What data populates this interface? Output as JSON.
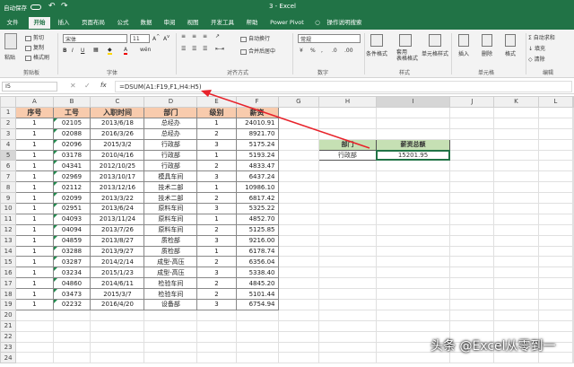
{
  "title": {
    "text": "3  -  Excel",
    "autosave": "自动保存"
  },
  "tabs": [
    "文件",
    "开始",
    "插入",
    "页面布局",
    "公式",
    "数据",
    "审阅",
    "视图",
    "开发工具",
    "帮助",
    "Power Pivot",
    "操作说明搜索"
  ],
  "ribbon": {
    "clipboard": {
      "cut": "剪切",
      "copy": "复制",
      "format_painter": "格式刷",
      "paste": "粘贴",
      "group": "剪贴板"
    },
    "font": {
      "name": "宋体",
      "size": "11",
      "group": "字体"
    },
    "align": {
      "wrap": "自动换行",
      "merge": "合并后居中",
      "group": "对齐方式"
    },
    "number": {
      "format": "常规",
      "group": "数字"
    },
    "styles": {
      "cond": "条件格式",
      "table": "套用\n表格格式",
      "cell": "单元格样式",
      "group": "样式"
    },
    "cells": {
      "insert": "插入",
      "delete": "删除",
      "format": "格式",
      "group": "单元格"
    },
    "edit": {
      "autosum": "自动求和",
      "fill": "填充",
      "clear": "清除",
      "group": "编辑"
    }
  },
  "formula_bar": {
    "name_box": "I5",
    "fx": "fx",
    "formula": "=DSUM(A1:F19,F1,H4:H5)"
  },
  "columns": [
    "A",
    "B",
    "C",
    "D",
    "E",
    "F",
    "G",
    "H",
    "I",
    "J",
    "K",
    "L"
  ],
  "header": [
    "序号",
    "工号",
    "入职时间",
    "部门",
    "级别",
    "薪资"
  ],
  "rows": [
    [
      "1",
      "02105",
      "2013/6/18",
      "总经办",
      "1",
      "24010.91"
    ],
    [
      "1",
      "02088",
      "2016/3/26",
      "总经办",
      "2",
      "8921.70"
    ],
    [
      "1",
      "02096",
      "2015/3/2",
      "行政部",
      "3",
      "5175.24"
    ],
    [
      "1",
      "03178",
      "2010/4/16",
      "行政部",
      "1",
      "5193.24"
    ],
    [
      "1",
      "04341",
      "2012/10/25",
      "行政部",
      "2",
      "4833.47"
    ],
    [
      "1",
      "02969",
      "2013/10/17",
      "模具车间",
      "3",
      "6437.24"
    ],
    [
      "1",
      "02112",
      "2013/12/16",
      "技术二部",
      "1",
      "10986.10"
    ],
    [
      "1",
      "02099",
      "2013/3/22",
      "技术二部",
      "2",
      "6817.42"
    ],
    [
      "1",
      "02951",
      "2013/6/24",
      "原料车间",
      "3",
      "5325.22"
    ],
    [
      "1",
      "04093",
      "2013/11/24",
      "原料车间",
      "1",
      "4852.70"
    ],
    [
      "1",
      "04094",
      "2013/7/26",
      "原料车间",
      "2",
      "5125.85"
    ],
    [
      "1",
      "04859",
      "2013/8/27",
      "质检部",
      "3",
      "9216.00"
    ],
    [
      "1",
      "03288",
      "2013/9/27",
      "质检部",
      "1",
      "6178.74"
    ],
    [
      "1",
      "03287",
      "2014/2/14",
      "成型-高压",
      "2",
      "6356.04"
    ],
    [
      "1",
      "03234",
      "2015/1/23",
      "成型-高压",
      "3",
      "5338.40"
    ],
    [
      "1",
      "04860",
      "2014/6/11",
      "检验车间",
      "2",
      "4845.20"
    ],
    [
      "1",
      "03473",
      "2015/3/7",
      "检验车间",
      "2",
      "5101.44"
    ],
    [
      "1",
      "02232",
      "2016/4/20",
      "设备部",
      "3",
      "6754.94"
    ]
  ],
  "criteria": {
    "h_header": "部门",
    "h_value": "行政部",
    "i_header": "薪资总额",
    "i_value": "15201.95"
  },
  "watermark": "头条 @Excel从零到一",
  "colors": {
    "excel_green": "#217346",
    "header_fill": "#f8cbad",
    "criteria_fill": "#c6e0b4",
    "arrow": "#e8232b"
  }
}
